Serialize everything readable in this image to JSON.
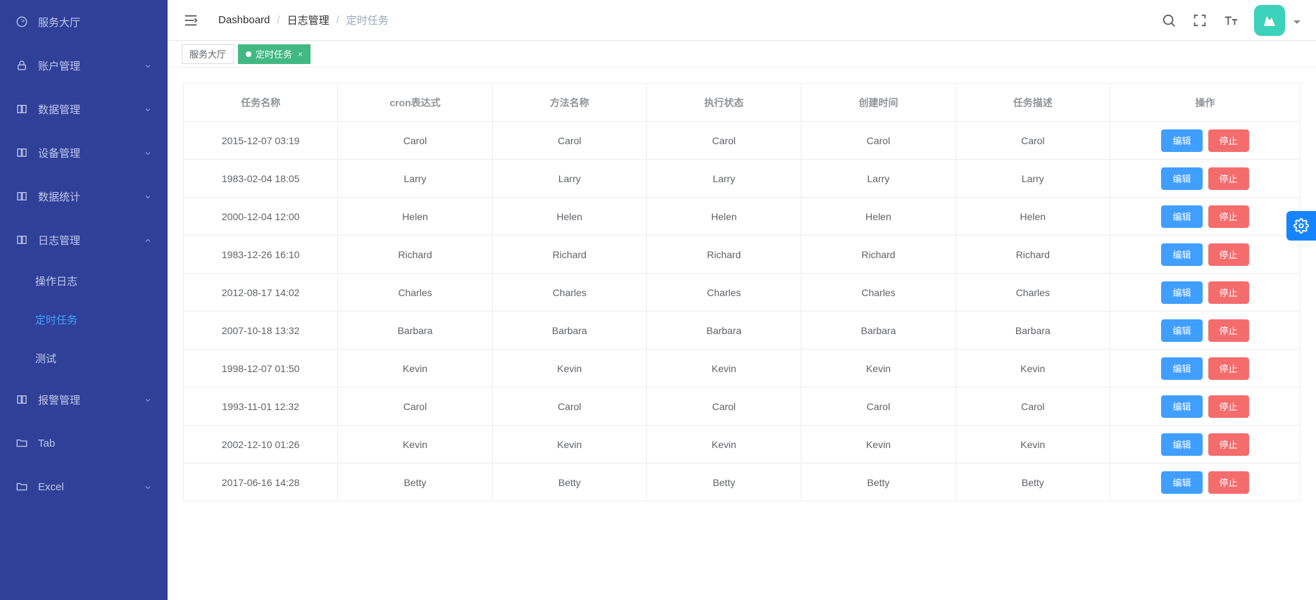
{
  "sidebar": {
    "items": [
      {
        "label": "服务大厅",
        "icon": "dashboard-icon",
        "expandable": false
      },
      {
        "label": "账户管理",
        "icon": "lock-icon",
        "expandable": true
      },
      {
        "label": "数据管理",
        "icon": "layers-icon",
        "expandable": true
      },
      {
        "label": "设备管理",
        "icon": "layers-icon",
        "expandable": true
      },
      {
        "label": "数据统计",
        "icon": "layers-icon",
        "expandable": true
      },
      {
        "label": "日志管理",
        "icon": "layers-icon",
        "expandable": true,
        "expanded": true,
        "children": [
          {
            "label": "操作日志",
            "active": false
          },
          {
            "label": "定时任务",
            "active": true
          },
          {
            "label": "测试",
            "active": false
          }
        ]
      },
      {
        "label": "报警管理",
        "icon": "layers-icon",
        "expandable": true
      },
      {
        "label": "Tab",
        "icon": "folder-icon",
        "expandable": false
      },
      {
        "label": "Excel",
        "icon": "folder-icon",
        "expandable": true
      }
    ]
  },
  "breadcrumb": {
    "items": [
      "Dashboard",
      "日志管理",
      "定时任务"
    ]
  },
  "tags": [
    {
      "label": "服务大厅",
      "active": false,
      "closable": false
    },
    {
      "label": "定时任务",
      "active": true,
      "closable": true
    }
  ],
  "table": {
    "columns": [
      "任务名称",
      "cron表达式",
      "方法名称",
      "执行状态",
      "创建时间",
      "任务描述",
      "操作"
    ],
    "actions": {
      "edit": "编辑",
      "stop": "停止"
    },
    "rows": [
      {
        "cells": [
          "2015-12-07 03:19",
          "Carol",
          "Carol",
          "Carol",
          "Carol",
          "Carol"
        ]
      },
      {
        "cells": [
          "1983-02-04 18:05",
          "Larry",
          "Larry",
          "Larry",
          "Larry",
          "Larry"
        ]
      },
      {
        "cells": [
          "2000-12-04 12:00",
          "Helen",
          "Helen",
          "Helen",
          "Helen",
          "Helen"
        ]
      },
      {
        "cells": [
          "1983-12-26 16:10",
          "Richard",
          "Richard",
          "Richard",
          "Richard",
          "Richard"
        ]
      },
      {
        "cells": [
          "2012-08-17 14:02",
          "Charles",
          "Charles",
          "Charles",
          "Charles",
          "Charles"
        ]
      },
      {
        "cells": [
          "2007-10-18 13:32",
          "Barbara",
          "Barbara",
          "Barbara",
          "Barbara",
          "Barbara"
        ]
      },
      {
        "cells": [
          "1998-12-07 01:50",
          "Kevin",
          "Kevin",
          "Kevin",
          "Kevin",
          "Kevin"
        ]
      },
      {
        "cells": [
          "1993-11-01 12:32",
          "Carol",
          "Carol",
          "Carol",
          "Carol",
          "Carol"
        ]
      },
      {
        "cells": [
          "2002-12-10 01:26",
          "Kevin",
          "Kevin",
          "Kevin",
          "Kevin",
          "Kevin"
        ]
      },
      {
        "cells": [
          "2017-06-16 14:28",
          "Betty",
          "Betty",
          "Betty",
          "Betty",
          "Betty"
        ]
      }
    ]
  }
}
